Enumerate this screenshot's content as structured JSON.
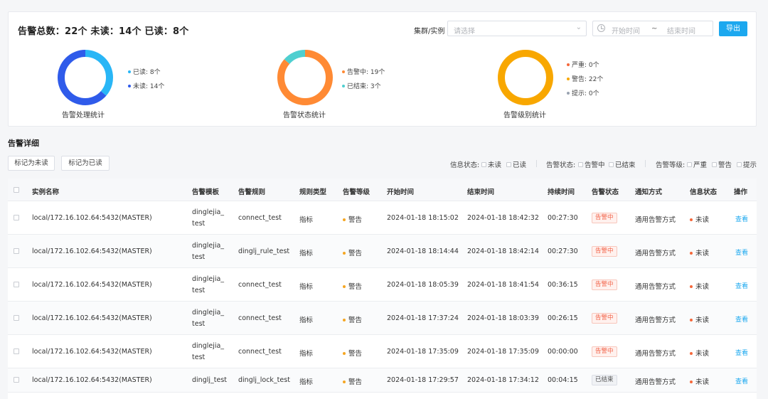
{
  "summary": {
    "title": "告警总数：22个  未读：14个  已读：8个",
    "cluster_label": "集群/实例",
    "cluster_placeholder": "请选择",
    "date_start_placeholder": "开始时间",
    "date_sep": "~",
    "date_end_placeholder": "结束时间",
    "export_label": "导出"
  },
  "charts": [
    {
      "caption": "告警处理统计",
      "segments": [
        {
          "label": "已读: 8个",
          "value": 8,
          "color": "#29b6f6"
        },
        {
          "label": "未读: 14个",
          "value": 14,
          "color": "#2f5bea"
        }
      ]
    },
    {
      "caption": "告警状态统计",
      "segments": [
        {
          "label": "告警中: 19个",
          "value": 19,
          "color": "#ff8a34"
        },
        {
          "label": "已结束: 3个",
          "value": 3,
          "color": "#4fcfd0"
        }
      ]
    },
    {
      "caption": "告警级别统计",
      "segments": [
        {
          "label": "严重: 0个",
          "value": 0,
          "color": "#f5683b"
        },
        {
          "label": "警告: 22个",
          "value": 22,
          "color": "#f8a700"
        },
        {
          "label": "提示: 0个",
          "value": 0,
          "color": "#9aa3b1"
        }
      ]
    }
  ],
  "details": {
    "title": "告警详细",
    "mark_unread": "标记为未读",
    "mark_read": "标记为已读",
    "filters": {
      "info_status_label": "信息状态:",
      "info_status_options": [
        "未读",
        "已读"
      ],
      "alert_status_label": "告警状态:",
      "alert_status_options": [
        "告警中",
        "已结束"
      ],
      "alert_level_label": "告警等级:",
      "alert_level_options": [
        "严重",
        "警告",
        "提示"
      ]
    }
  },
  "table": {
    "headers": [
      "实例名称",
      "告警模板",
      "告警规则",
      "规则类型",
      "告警等级",
      "开始时间",
      "结束时间",
      "持续时间",
      "告警状态",
      "通知方式",
      "信息状态",
      "操作"
    ],
    "rows": [
      {
        "instance": "local/172.16.102.64:5432(MASTER)",
        "template": "dinglejia_test",
        "rule": "connect_test",
        "rule_type": "指标",
        "level": "警告",
        "start": "2024-01-18 18:15:02",
        "end": "2024-01-18 18:42:32",
        "duration": "00:27:30",
        "status": "告警中",
        "notify": "通用告警方式",
        "info": "未读",
        "action": "查看"
      },
      {
        "instance": "local/172.16.102.64:5432(MASTER)",
        "template": "dinglejia_test",
        "rule": "dinglj_rule_test",
        "rule_type": "指标",
        "level": "警告",
        "start": "2024-01-18 18:14:44",
        "end": "2024-01-18 18:42:14",
        "duration": "00:27:30",
        "status": "告警中",
        "notify": "通用告警方式",
        "info": "未读",
        "action": "查看"
      },
      {
        "instance": "local/172.16.102.64:5432(MASTER)",
        "template": "dinglejia_test",
        "rule": "connect_test",
        "rule_type": "指标",
        "level": "警告",
        "start": "2024-01-18 18:05:39",
        "end": "2024-01-18 18:41:54",
        "duration": "00:36:15",
        "status": "告警中",
        "notify": "通用告警方式",
        "info": "未读",
        "action": "查看"
      },
      {
        "instance": "local/172.16.102.64:5432(MASTER)",
        "template": "dinglejia_test",
        "rule": "connect_test",
        "rule_type": "指标",
        "level": "警告",
        "start": "2024-01-18 17:37:24",
        "end": "2024-01-18 18:03:39",
        "duration": "00:26:15",
        "status": "告警中",
        "notify": "通用告警方式",
        "info": "未读",
        "action": "查看"
      },
      {
        "instance": "local/172.16.102.64:5432(MASTER)",
        "template": "dinglejia_test",
        "rule": "connect_test",
        "rule_type": "指标",
        "level": "警告",
        "start": "2024-01-18 17:35:09",
        "end": "2024-01-18 17:35:09",
        "duration": "00:00:00",
        "status": "告警中",
        "notify": "通用告警方式",
        "info": "未读",
        "action": "查看"
      },
      {
        "instance": "local/172.16.102.64:5432(MASTER)",
        "template": "dinglj_test",
        "rule": "dinglj_lock_test",
        "rule_type": "指标",
        "level": "警告",
        "start": "2024-01-18 17:29:57",
        "end": "2024-01-18 17:34:12",
        "duration": "00:04:15",
        "status": "已结束",
        "notify": "通用告警方式",
        "info": "未读",
        "action": "查看"
      }
    ]
  }
}
